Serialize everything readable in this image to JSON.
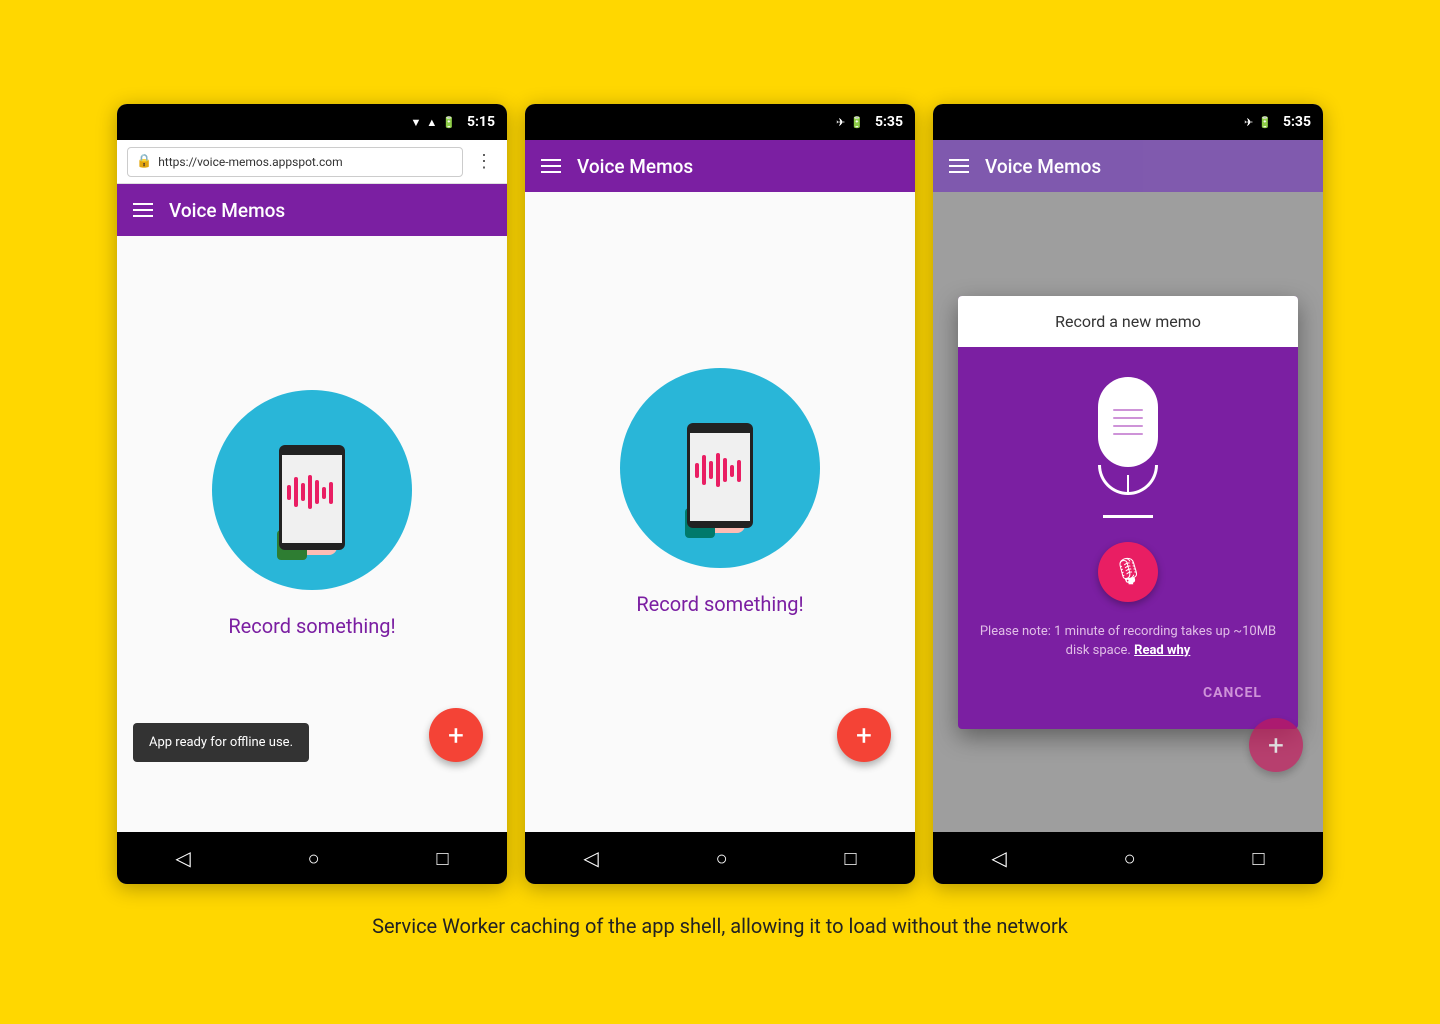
{
  "background_color": "#FFD700",
  "caption": "Service Worker caching of the app shell, allowing it to load without the network",
  "phones": [
    {
      "id": "phone1",
      "status_bar": {
        "icons": [
          "wifi",
          "signal",
          "battery"
        ],
        "time": "5:15"
      },
      "chrome_bar": {
        "url": "https://voice-memos.appspot.com",
        "show_lock": true
      },
      "toolbar": {
        "title": "Voice Memos",
        "show_hamburger": true
      },
      "content": {
        "record_text": "Record something!",
        "show_illustration": true,
        "show_snackbar": true,
        "snackbar_text": "App ready for offline use."
      },
      "fab_label": "+"
    },
    {
      "id": "phone2",
      "status_bar": {
        "icons": [
          "airplane",
          "battery"
        ],
        "time": "5:35"
      },
      "chrome_bar": null,
      "toolbar": {
        "title": "Voice Memos",
        "show_hamburger": true
      },
      "content": {
        "record_text": "Record something!",
        "show_illustration": true,
        "show_snackbar": false,
        "snackbar_text": ""
      },
      "fab_label": "+"
    },
    {
      "id": "phone3",
      "status_bar": {
        "icons": [
          "airplane",
          "battery"
        ],
        "time": "5:35"
      },
      "chrome_bar": null,
      "toolbar": {
        "title": "Voice Memos",
        "show_hamburger": true,
        "dimmed": true
      },
      "content": {
        "show_dialog": true,
        "dialog_title": "Record a new memo",
        "dialog_note": "Please note: 1 minute of recording takes up ~10MB disk space.",
        "dialog_note_link": "Read why",
        "dialog_cancel": "CANCEL"
      },
      "fab_label": "+"
    }
  ]
}
